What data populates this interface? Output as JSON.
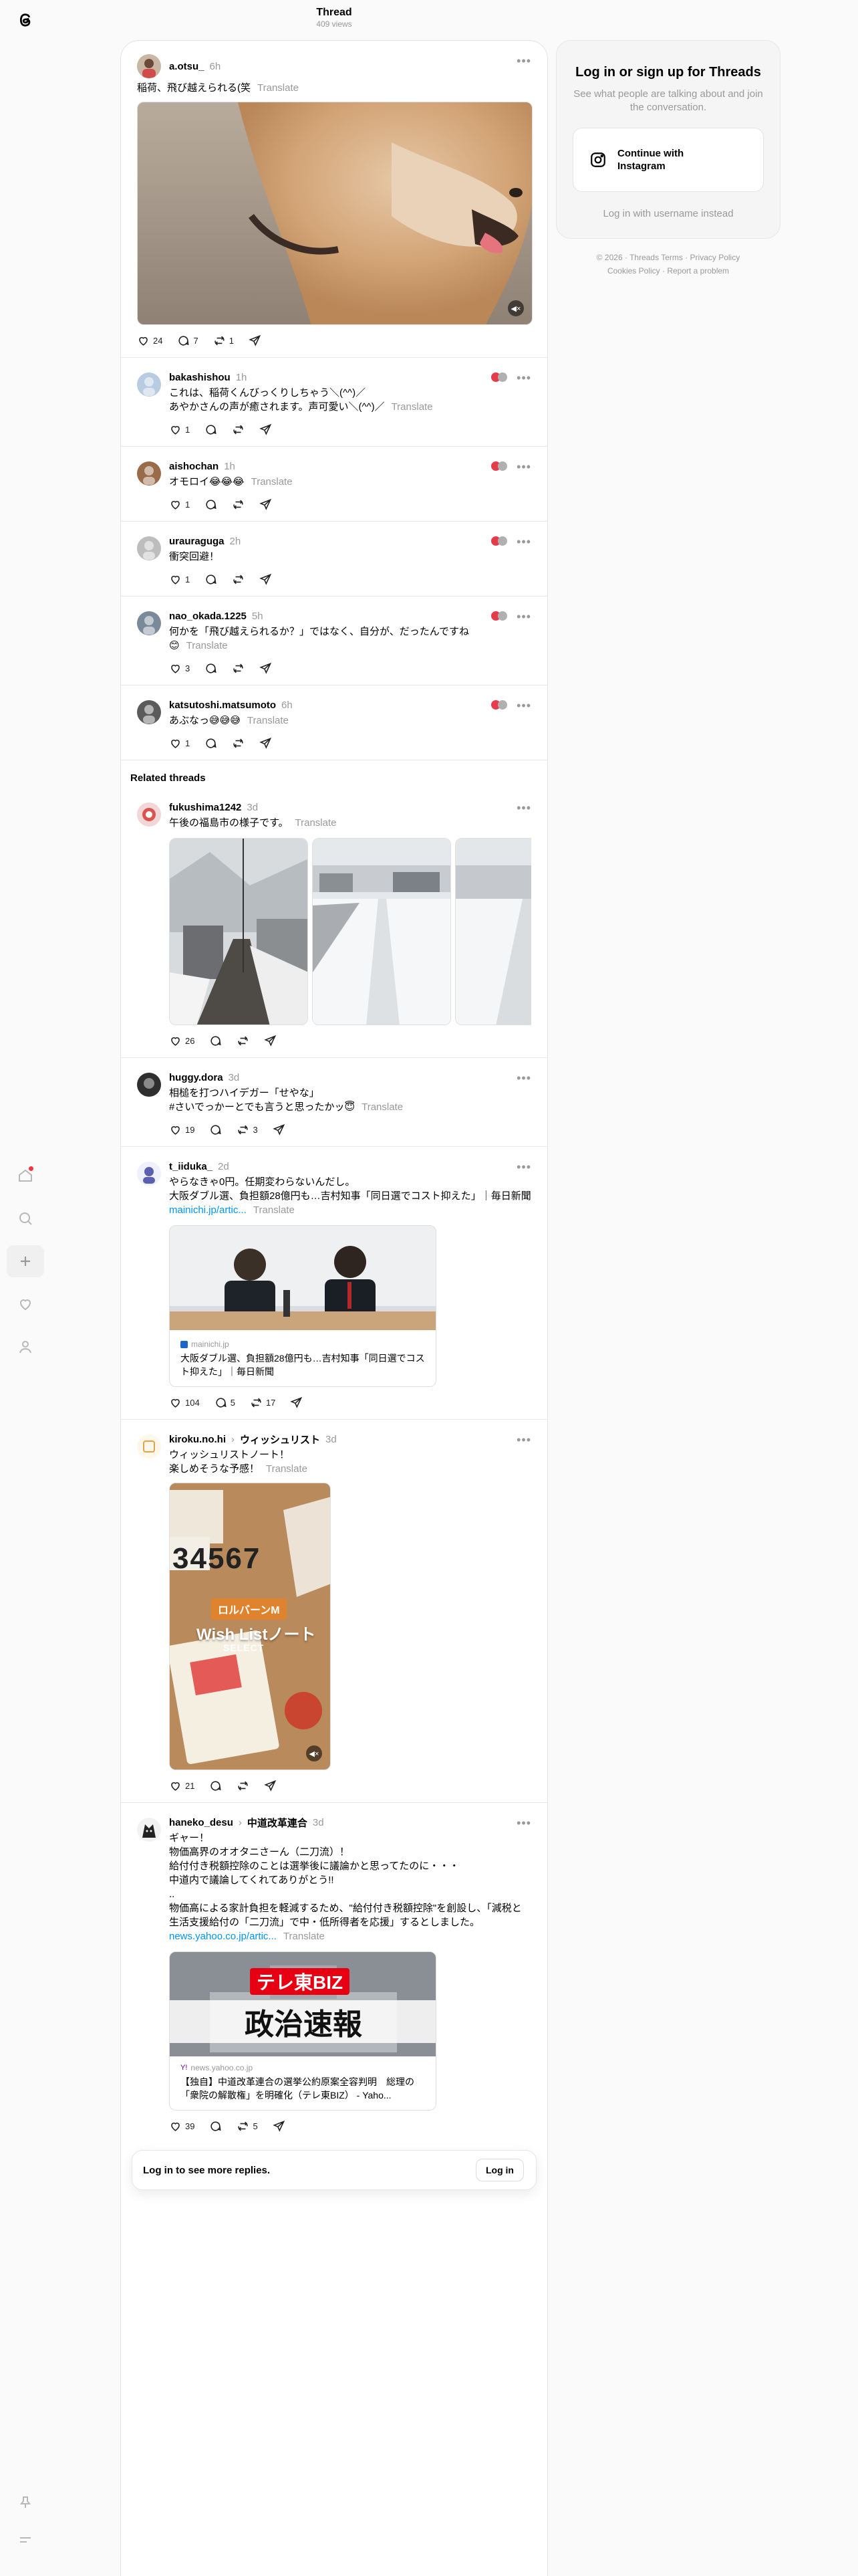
{
  "header": {
    "title": "Thread",
    "views": "409 views"
  },
  "nav": {
    "logo": "@"
  },
  "main_post": {
    "username": "a.otsu_",
    "time": "6h",
    "text": "稲荷、飛び越えられる(笑",
    "translate": "Translate",
    "likes": "24",
    "replies": "7",
    "reposts": "1"
  },
  "replies": [
    {
      "username": "bakashishou",
      "time": "1h",
      "text": "これは、稲荷くんびっくりしちゃう＼(^^)／\nあやかさんの声が癒されます。声可愛い＼(^^)／",
      "translate": "Translate",
      "likes": "1"
    },
    {
      "username": "aishochan",
      "time": "1h",
      "text": "オモロイ😂😂😂",
      "translate": "Translate",
      "likes": "1"
    },
    {
      "username": "urauraguga",
      "time": "2h",
      "text": "衝突回避！",
      "translate": "",
      "likes": "1"
    },
    {
      "username": "nao_okada.1225",
      "time": "5h",
      "text": "何かを「飛び越えられるか？」ではなく、自分が、だったんですね\n😊",
      "translate": "Translate",
      "likes": "3"
    },
    {
      "username": "katsutoshi.matsumoto",
      "time": "6h",
      "text": "あぶなっ😅😅😅",
      "translate": "Translate",
      "likes": "1"
    }
  ],
  "related_heading": "Related threads",
  "related": [
    {
      "username": "fukushima1242",
      "time": "3d",
      "text": "午後の福島市の様子です。",
      "translate": "Translate",
      "likes": "26"
    },
    {
      "username": "huggy.dora",
      "time": "3d",
      "text": "相槌を打つハイデガー「せやな」\n#さいでっかーとでも言うと思ったかッ😇",
      "translate": "Translate",
      "likes": "19",
      "reposts": "3"
    },
    {
      "username": "t_iiduka_",
      "time": "2d",
      "text": "やらなきゃ0円。任期変わらないんだし。\n大阪ダブル選、負担額28億円も…吉村知事「同日選でコスト抑えた」｜毎日新聞",
      "link": "mainichi.jp/artic...",
      "translate": "Translate",
      "card_domain": "mainichi.jp",
      "card_title": "大阪ダブル選、負担額28億円も…吉村知事「同日選でコスト抑えた」｜毎日新聞",
      "likes": "104",
      "replies": "5",
      "reposts": "17"
    },
    {
      "username": "kiroku.no.hi",
      "topic": "ウィッシュリスト",
      "time": "3d",
      "text": "ウィッシュリストノート！\n楽しめそうな予感！",
      "translate": "Translate",
      "image_text_1": "ロルバーンM",
      "image_text_2": "Wish Listノート",
      "image_text_3": "SELECT",
      "likes": "21"
    },
    {
      "username": "haneko_desu",
      "topic": "中道改革連合",
      "time": "3d",
      "text": "ギャー！\n物価高界のオオタニさーん（二刀流）！\n給付付き税額控除のことは選挙後に議論かと思ってたのに・・・\n中道内で議論してくれてありがとう!!\n..\n物価高による家計負担を軽減するため、\"給付付き税額控除\"を創設し、「減税と生活支援給付の「二刀流」で中・低所得者を応援」するとしました。",
      "link": "news.yahoo.co.jp/artic...",
      "translate": "Translate",
      "card_brand": "テレ東BIZ",
      "card_banner": "政治速報",
      "card_domain": "news.yahoo.co.jp",
      "card_title": "【独自】中道改革連合の選挙公約原案全容判明　総理の「衆院の解散権」を明確化（テレ東BIZ） - Yaho...",
      "likes": "39",
      "reposts": "5"
    }
  ],
  "login_bar": {
    "text": "Log in to see more replies.",
    "button": "Log in"
  },
  "side": {
    "title": "Log in or sign up for Threads",
    "subtitle": "See what people are talking about and join the conversation.",
    "ig_button": "Continue with Instagram",
    "alt_login": "Log in with username instead",
    "footer_line1": "© 2026 · Threads Terms · Privacy Policy",
    "footer_line2": "Cookies Policy · Report a problem"
  },
  "colors": {
    "link": "#0095f6",
    "muted": "#999999",
    "notify_dot": "#ff3040"
  }
}
